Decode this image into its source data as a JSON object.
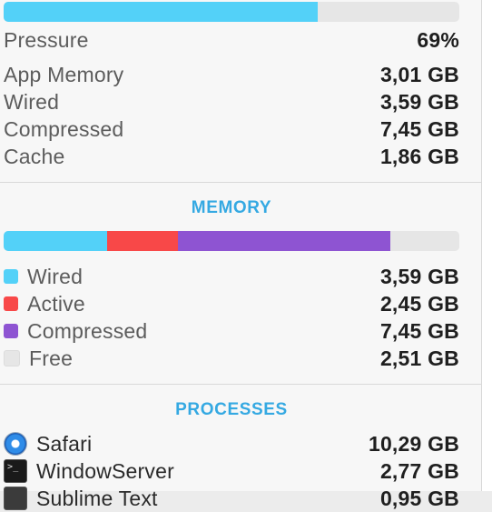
{
  "pressure": {
    "label": "Pressure",
    "value": "69%",
    "level": 0.69,
    "color": "#53d1f8"
  },
  "stats": [
    {
      "label": "App Memory",
      "value": "3,01 GB"
    },
    {
      "label": "Wired",
      "value": "3,59 GB"
    },
    {
      "label": "Compressed",
      "value": "7,45 GB"
    },
    {
      "label": "Cache",
      "value": "1,86 GB"
    }
  ],
  "memory": {
    "title": "MEMORY",
    "legend": [
      {
        "label": "Wired",
        "value": "3,59 GB",
        "color": "#53d1f8"
      },
      {
        "label": "Active",
        "value": "2,45 GB",
        "color": "#f84848"
      },
      {
        "label": "Compressed",
        "value": "7,45 GB",
        "color": "#8e54d2"
      },
      {
        "label": "Free",
        "value": "2,51 GB",
        "color": "#e6e6e6"
      }
    ]
  },
  "processes": {
    "title": "PROCESSES",
    "items": [
      {
        "name": "Safari",
        "value": "10,29 GB",
        "icon": "safari-icon"
      },
      {
        "name": "WindowServer",
        "value": "2,77 GB",
        "icon": "terminal-icon"
      },
      {
        "name": "Sublime Text",
        "value": "0,95 GB",
        "icon": "sublime-text-icon"
      }
    ]
  }
}
